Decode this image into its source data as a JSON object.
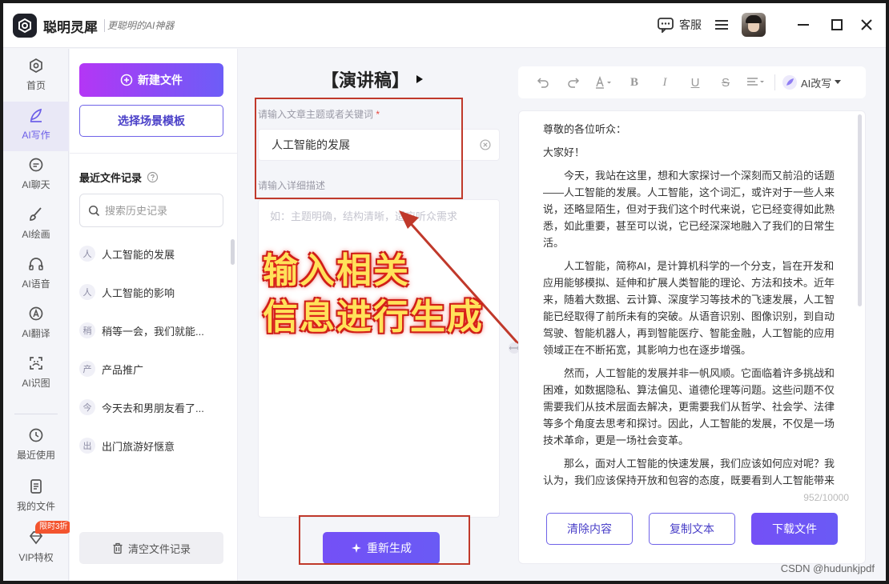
{
  "app": {
    "name": "聪明灵犀",
    "slogan": "更聪明的AI神器",
    "service_label": "客服"
  },
  "nav": {
    "items": [
      {
        "label": "首页",
        "icon": "home-icon"
      },
      {
        "label": "AI写作",
        "icon": "pen-icon",
        "active": true
      },
      {
        "label": "AI聊天",
        "icon": "chat-icon"
      },
      {
        "label": "AI绘画",
        "icon": "brush-icon"
      },
      {
        "label": "AI语音",
        "icon": "headphones-icon"
      },
      {
        "label": "AI翻译",
        "icon": "translate-icon"
      },
      {
        "label": "AI识图",
        "icon": "image-scan-icon"
      },
      {
        "label": "最近使用",
        "icon": "history-icon"
      },
      {
        "label": "我的文件",
        "icon": "file-icon"
      },
      {
        "label": "VIP特权",
        "icon": "diamond-icon"
      }
    ],
    "vip_badge": "限时3折"
  },
  "files": {
    "new_button": "新建文件",
    "template_button": "选择场景模板",
    "recent_title": "最近文件记录",
    "search_placeholder": "搜索历史记录",
    "history": [
      {
        "icon": "人",
        "text": "人工智能的发展"
      },
      {
        "icon": "人",
        "text": "人工智能的影响"
      },
      {
        "icon": "稍",
        "text": "稍等一会，我们就能..."
      },
      {
        "icon": "产",
        "text": "产品推广"
      },
      {
        "icon": "今",
        "text": "今天去和男朋友看了..."
      },
      {
        "icon": "出",
        "text": "出门旅游好惬意"
      }
    ],
    "clear_button": "清空文件记录"
  },
  "form": {
    "doc_type": "【演讲稿】",
    "topic_label": "请输入文章主题或者关键词",
    "topic_required": "*",
    "topic_value": "人工智能的发展",
    "detail_label": "请输入详细描述",
    "detail_placeholder": "如：主题明确，结构清晰，适应听众需求",
    "regen_button": "重新生成"
  },
  "annotation": {
    "line1": "输入相关",
    "line2": "信息进行生成"
  },
  "editor": {
    "ai_rewrite": "AI改写",
    "paragraphs": [
      "尊敬的各位听众：",
      "大家好！",
      "今天，我站在这里，想和大家探讨一个深刻而又前沿的话题——人工智能的发展。人工智能，这个词汇，或许对于一些人来说，还略显陌生，但对于我们这个时代来说，它已经变得如此熟悉，如此重要，甚至可以说，它已经深深地融入了我们的日常生活。",
      "人工智能，简称AI，是计算机科学的一个分支，旨在开发和应用能够模拟、延伸和扩展人类智能的理论、方法和技术。近年来，随着大数据、云计算、深度学习等技术的飞速发展，人工智能已经取得了前所未有的突破。从语音识别、图像识别，到自动驾驶、智能机器人，再到智能医疗、智能金融，人工智能的应用领域正在不断拓宽，其影响力也在逐步增强。",
      "然而，人工智能的发展并非一帆风顺。它面临着许多挑战和困难，如数据隐私、算法偏见、道德伦理等问题。这些问题不仅需要我们从技术层面去解决，更需要我们从哲学、社会学、法律等多个角度去思考和探讨。因此，人工智能的发展，不仅是一场技术革命，更是一场社会变革。",
      "那么，面对人工智能的快速发展，我们应该如何应对呢？我认为，我们应该保持开放和包容的态度，既要看到人工智能带来的"
    ],
    "char_count": "952/10000",
    "clear_button": "清除内容",
    "copy_button": "复制文本",
    "download_button": "下载文件"
  },
  "watermark": "CSDN @hudunkjpdf",
  "colors": {
    "accent": "#6a5af5",
    "gradient_start": "#b436f5",
    "annotation_fill": "#ffe25a",
    "annotation_glow": "#e0241c",
    "highlight_box": "#c0392b"
  }
}
